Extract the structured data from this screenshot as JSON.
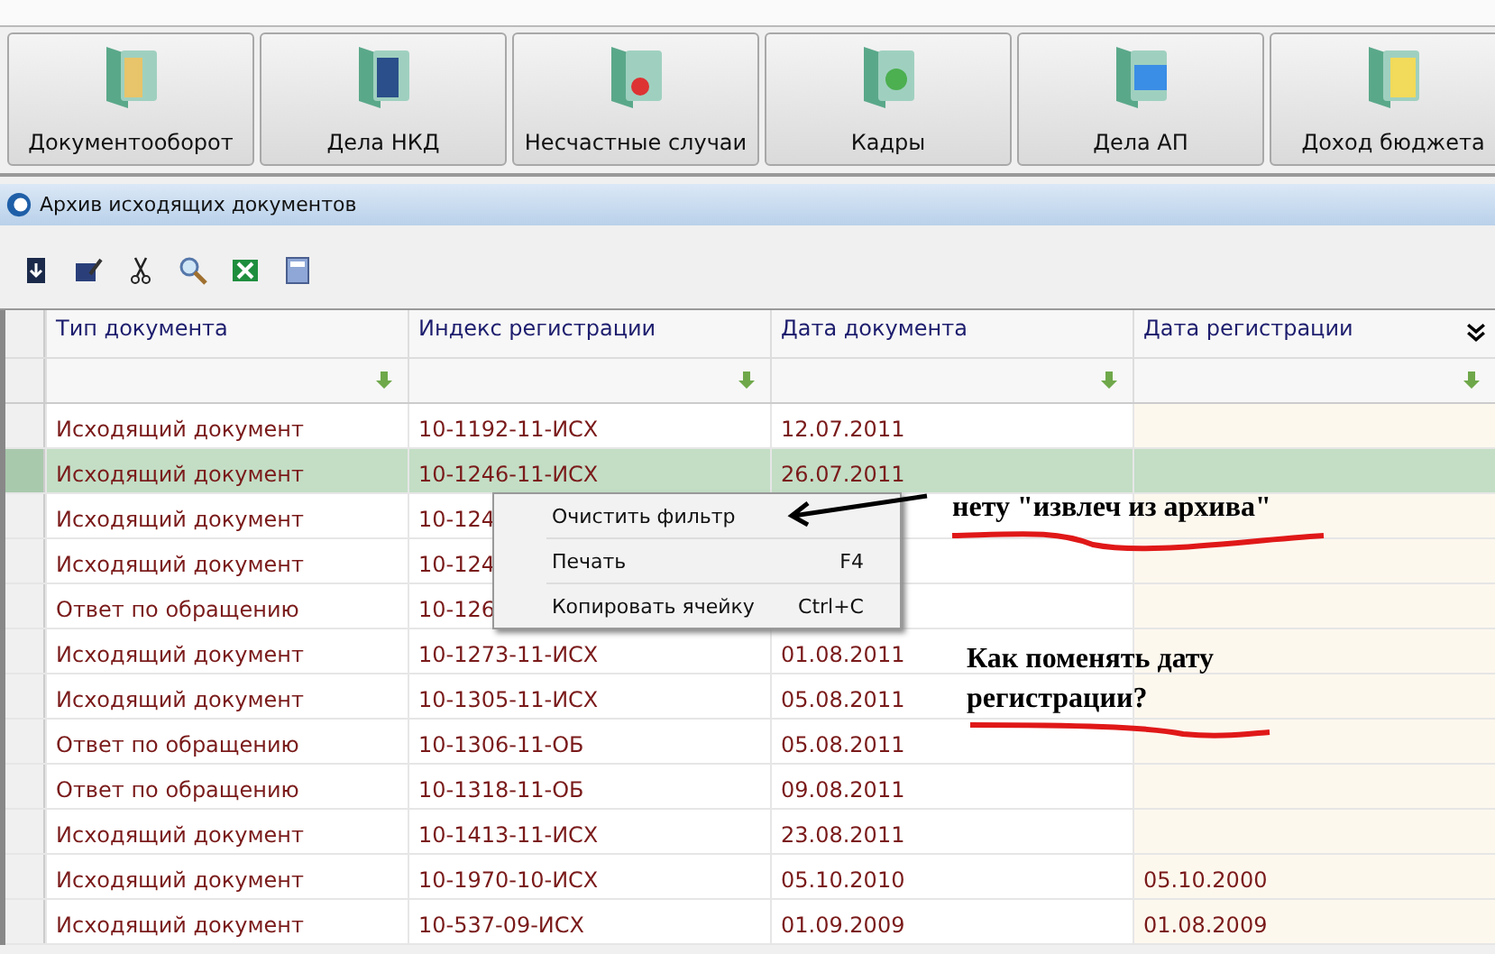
{
  "modules": [
    {
      "label": "Документооборот"
    },
    {
      "label": "Дела НКД"
    },
    {
      "label": "Несчастные случаи"
    },
    {
      "label": "Кадры"
    },
    {
      "label": "Дела АП"
    },
    {
      "label": "Доход бюджета"
    }
  ],
  "window": {
    "title": "Архив исходящих документов"
  },
  "table": {
    "columns": [
      "Тип документа",
      "Индекс регистрации",
      "Дата документа",
      "Дата регистрации"
    ],
    "rows": [
      {
        "type": "Исходящий документ",
        "index": "10-1192-11-ИСХ",
        "doc_date": "12.07.2011",
        "selected": false
      },
      {
        "type": "Исходящий документ",
        "index": "10-1246-11-ИСХ",
        "doc_date": "26.07.2011",
        "selected": true
      },
      {
        "type": "Исходящий документ",
        "index": "10-124",
        "selected": false
      },
      {
        "type": "Исходящий документ",
        "index": "10-124",
        "selected": false
      },
      {
        "type": "Ответ по обращению",
        "index": "10-126",
        "selected": false
      },
      {
        "type": "Исходящий документ",
        "index": "10-1273-11-ИСХ",
        "doc_date": "01.08.2011",
        "selected": false
      },
      {
        "type": "Исходящий документ",
        "index": "10-1305-11-ИСХ",
        "doc_date": "05.08.2011",
        "selected": false
      },
      {
        "type": "Ответ по обращению",
        "index": "10-1306-11-ОБ",
        "doc_date": "05.08.2011",
        "selected": false
      },
      {
        "type": "Ответ по обращению",
        "index": "10-1318-11-ОБ",
        "doc_date": "09.08.2011",
        "selected": false
      },
      {
        "type": "Исходящий документ",
        "index": "10-1413-11-ИСХ",
        "doc_date": "23.08.2011",
        "selected": false
      },
      {
        "type": "Исходящий документ",
        "index": "10-1970-10-ИСХ",
        "doc_date": "05.10.2010",
        "reg_date": "05.10.2000",
        "selected": false
      },
      {
        "type": "Исходящий документ",
        "index": "10-537-09-ИСХ",
        "doc_date": "01.09.2009",
        "reg_date": "01.08.2009",
        "selected": false
      }
    ]
  },
  "context_menu": [
    {
      "label": "Очистить фильтр"
    },
    {
      "label": "Печать",
      "shortcut": "F4"
    },
    {
      "label": "Копировать ячейку",
      "shortcut": "Ctrl+C"
    }
  ],
  "annotations": [
    {
      "text": "нету \"извлеч из архива\""
    },
    {
      "text": "Как поменять дату регистрации?"
    }
  ]
}
